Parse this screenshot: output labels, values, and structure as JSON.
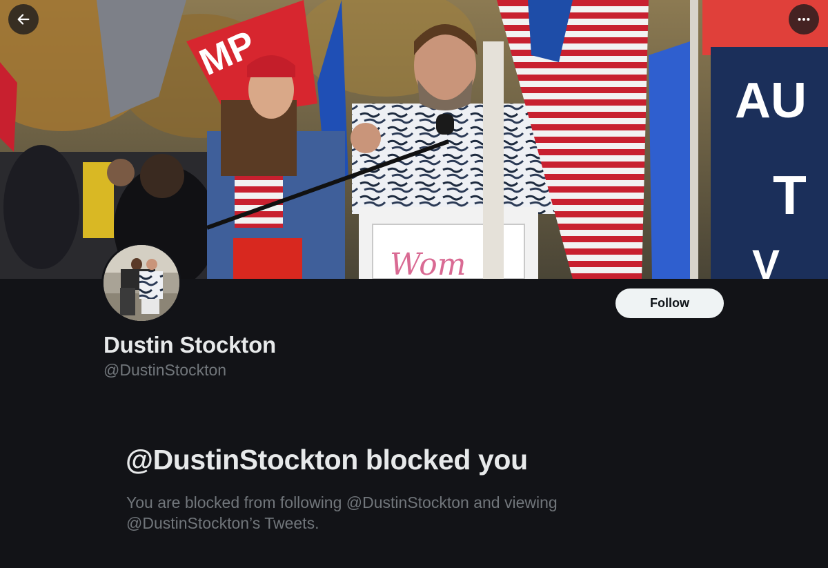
{
  "header": {
    "back_icon": "arrow-left-icon",
    "more_icon": "more-horizontal-icon"
  },
  "banner": {
    "description_icon": "banner-photo",
    "podium_text": "Wom"
  },
  "profile": {
    "display_name": "Dustin Stockton",
    "handle": "@DustinStockton",
    "follow_label": "Follow"
  },
  "blocked": {
    "title": "@DustinStockton blocked you",
    "message": "You are blocked from following @DustinStockton and viewing @DustinStockton’s Tweets."
  },
  "colors": {
    "background": "#121317",
    "text_primary": "#e7e9ea",
    "text_secondary": "#71767b",
    "follow_bg": "#eff3f4"
  }
}
